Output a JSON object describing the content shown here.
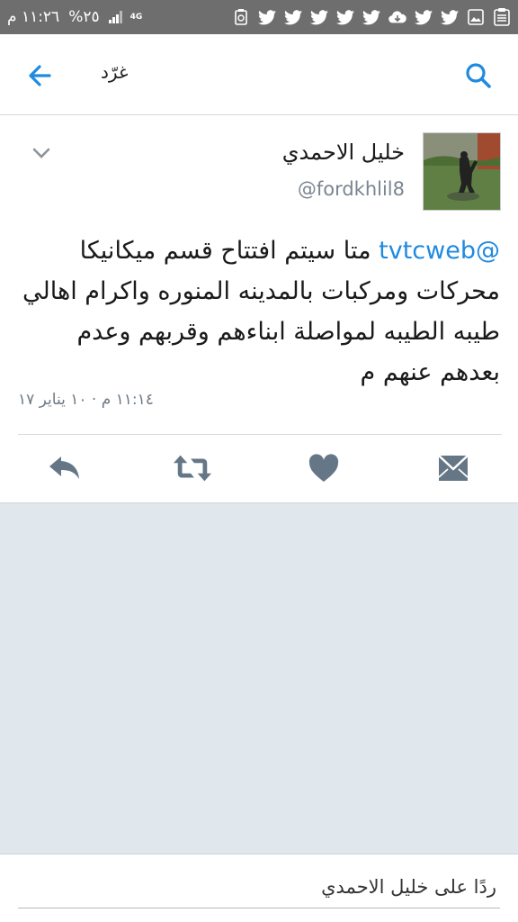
{
  "status_bar": {
    "time": "١١:٢٦ م",
    "battery": "%٢٥",
    "network": "4G",
    "notification_icons": [
      "clipboard-icon",
      "image-icon",
      "twitter-icon",
      "twitter-icon",
      "cloud-download-icon",
      "twitter-icon",
      "twitter-icon",
      "twitter-icon",
      "twitter-icon",
      "twitter-icon",
      "recycle-icon"
    ]
  },
  "app_bar": {
    "title": "غرّد",
    "back_icon": "back-arrow-icon",
    "search_icon": "search-icon"
  },
  "tweet": {
    "display_name": "خليل الاحمدي",
    "handle": "@fordkhlil8",
    "mention": "@tvtcweb",
    "text": " متا سيتم افتتاح قسم ميكانيكا محركات ومركبات بالمدينه المنوره واكرام اهالي طيبه الطيبه لمواصلة ابناءهم وقربهم وعدم بعدهم عنهم م",
    "timestamp": "١١:١٤ م · ١٠ يناير ١٧"
  },
  "actions": {
    "reply_icon": "reply-icon",
    "retweet_icon": "retweet-icon",
    "like_icon": "heart-icon",
    "dm_icon": "envelope-icon"
  },
  "reply": {
    "placeholder": "ردًا على خليل الاحمدي"
  },
  "colors": {
    "accent": "#1f8ae0",
    "status_bar": "#6e6e6e",
    "empty_area": "#e1e8ed",
    "icon_grey": "#657786"
  }
}
